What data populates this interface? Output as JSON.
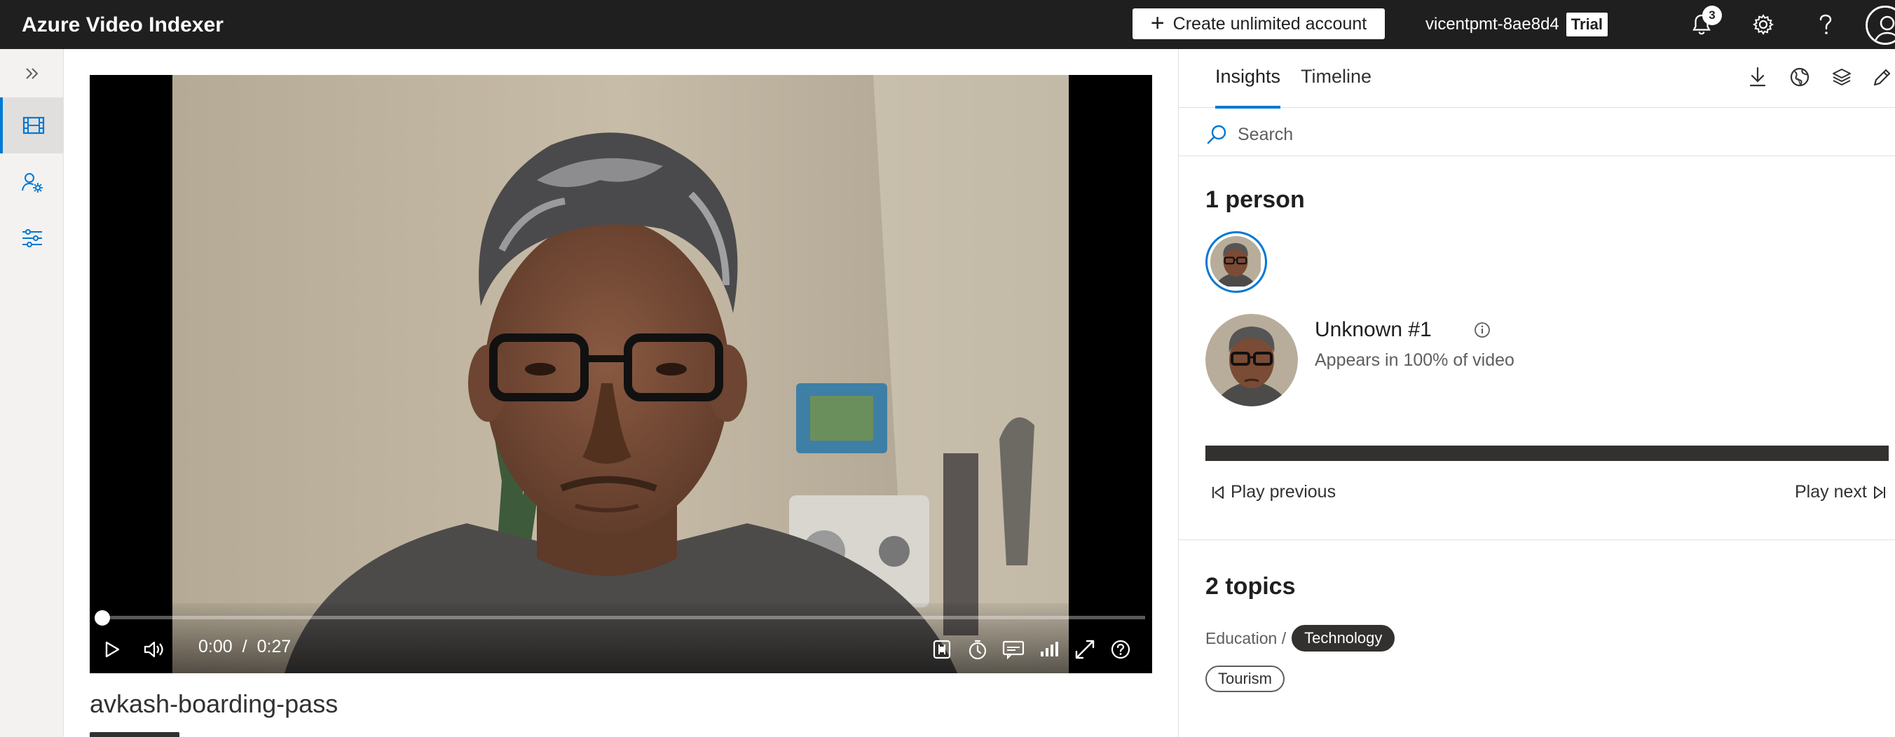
{
  "header": {
    "app_title": "Azure Video Indexer",
    "create_label": "Create unlimited account",
    "account_name": "vicentpmt-8ae8d4",
    "plan_badge": "Trial",
    "notification_count": "3",
    "icons": [
      "bell-icon",
      "gear-icon",
      "help-icon",
      "profile-avatar"
    ]
  },
  "sidebar": {
    "items": [
      {
        "name": "expand-icon"
      },
      {
        "name": "film-icon",
        "active": true
      },
      {
        "name": "person-settings-icon"
      },
      {
        "name": "sliders-icon"
      }
    ]
  },
  "player": {
    "current_time": "0:00",
    "separator": "/",
    "duration": "0:27",
    "progress": 0,
    "icons": [
      "play-icon",
      "volume-icon",
      "caption-track-icon",
      "timer-icon",
      "subtitles-icon",
      "quality-icon",
      "fullscreen-icon",
      "help-circle-icon"
    ]
  },
  "video_title": "avkash-boarding-pass",
  "insights": {
    "tabs": [
      {
        "label": "Insights",
        "active": true
      },
      {
        "label": "Timeline",
        "active": false
      }
    ],
    "toolbar_icons": [
      "download-icon",
      "globe-icon",
      "layers-icon",
      "edit-icon"
    ],
    "search_placeholder": "Search",
    "people": {
      "heading": "1 person",
      "name": "Unknown #1",
      "appearance": "Appears in 100% of video",
      "appearance_fraction": 1.0,
      "play_previous": "Play previous",
      "play_next": "Play next"
    },
    "topics": {
      "heading": "2 topics",
      "crumb_parent": "Education /",
      "items": [
        "Technology",
        "Tourism"
      ]
    }
  },
  "colors": {
    "accent": "#0078d4",
    "topbar": "#1f1f1f",
    "pill_dark": "#323130"
  }
}
